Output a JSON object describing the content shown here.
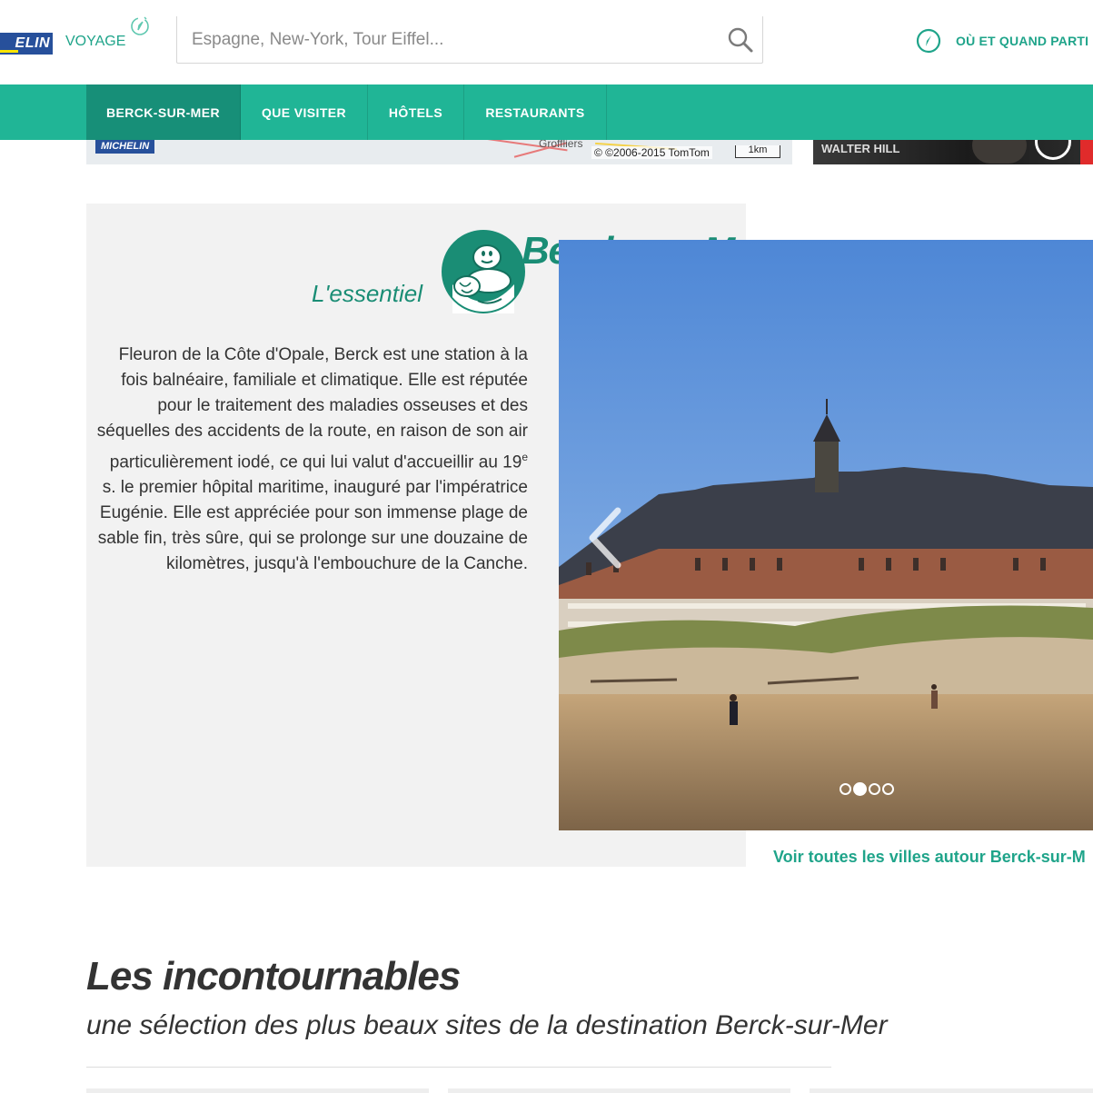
{
  "header": {
    "logo_text": "ELIN",
    "brand_sub": "VOYAGE",
    "search_placeholder": "Espagne, New-York, Tour Eiffel...",
    "where_when": "OÙ ET QUAND PARTI"
  },
  "nav": {
    "items": [
      {
        "label": "BERCK-SUR-MER",
        "active": true
      },
      {
        "label": "QUE VISITER",
        "active": false
      },
      {
        "label": "HÔTELS",
        "active": false
      },
      {
        "label": "RESTAURANTS",
        "active": false
      }
    ]
  },
  "map": {
    "logo": "MICHELIN",
    "place": "Groffliers",
    "copyright": "© ©2006-2015 TomTom",
    "scale": "1km"
  },
  "ad": {
    "text": "WALTER HILL"
  },
  "essentiel": {
    "title": "Berck-sur-Mer",
    "subtitle": "L'essentiel",
    "desc_before": "Fleuron de la Côte d'Opale, Berck est une station à la fois balnéaire, familiale et climatique. Elle est réputée pour le traitement des maladies osseuses et des séquelles des accidents de la route, en raison de son air particulièrement iodé, ce qui lui valut d'accueillir au 19",
    "desc_sup": "e",
    "desc_after": " s. le premier hôpital maritime, inauguré par l'impératrice Eugénie. Elle est appréciée pour son immense plage de sable fin, très sûre, qui se prolonge sur une douzaine de kilomètres, jusqu'à l'embouchure de la Canche."
  },
  "carousel": {
    "slide_count": 4,
    "active_index": 1
  },
  "around_link": "Voir toutes les villes autour Berck-sur-M",
  "section": {
    "title": "Les incontournables",
    "subtitle": "une sélection des plus beaux sites de la destination Berck-sur-Mer"
  },
  "colors": {
    "accent": "#20b596",
    "accent_dark": "#178f78",
    "title_green": "#1a8d75",
    "card_bg": "#f2f2f2",
    "michelin_blue": "#27509b"
  }
}
